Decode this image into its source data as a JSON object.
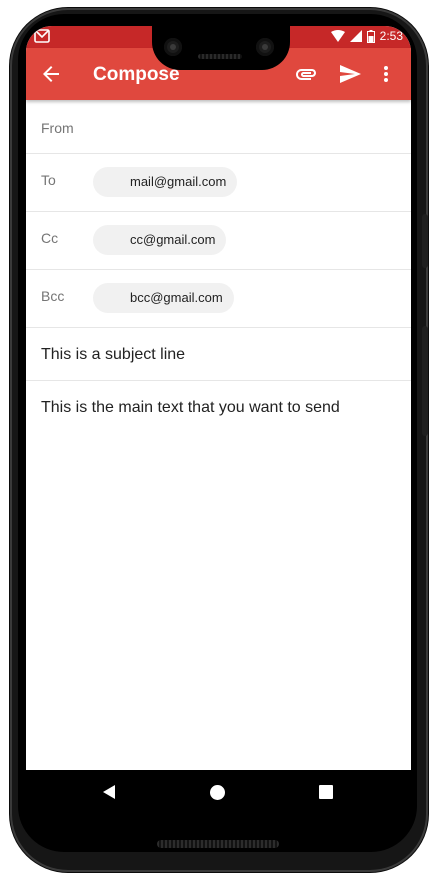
{
  "status_bar": {
    "time": "2:53",
    "icons": [
      "gmail-notification-icon",
      "wifi-icon",
      "signal-icon",
      "battery-icon"
    ]
  },
  "app_bar": {
    "title": "Compose",
    "icons": [
      "back-arrow-icon",
      "attach-icon",
      "send-icon",
      "more-vert-icon"
    ],
    "color": "#e0483e"
  },
  "compose": {
    "from": {
      "label": "From",
      "value": ""
    },
    "to": {
      "label": "To",
      "chip": "mail@gmail.com"
    },
    "cc": {
      "label": "Cc",
      "chip": "cc@gmail.com"
    },
    "bcc": {
      "label": "Bcc",
      "chip": "bcc@gmail.com"
    },
    "subject": "This is a subject line",
    "body": "This is the main text that you want to send"
  },
  "nav_bar": {
    "icons": [
      "nav-back-icon",
      "nav-home-icon",
      "nav-recents-icon"
    ]
  },
  "colors": {
    "status_bar": "#c62828",
    "app_bar": "#e0483e",
    "chip_bg": "#f1f1f1"
  }
}
